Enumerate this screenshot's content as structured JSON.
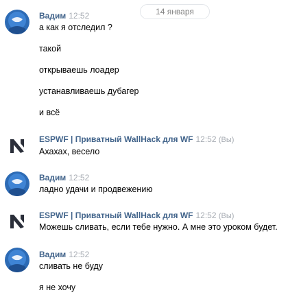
{
  "date_divider": "14 января",
  "colors": {
    "author": "#42648b",
    "time": "#a7acb3",
    "avatar_blue": "#2d6bb5",
    "text": "#000000"
  },
  "messages": [
    {
      "author": "Вадим",
      "time": "12:52",
      "avatar_icon": "blue-avatar-icon",
      "lines": [
        "а как я отследил ?",
        "такой",
        "открываешь лоадер",
        "устанавливаешь дубагер",
        "и всё"
      ]
    },
    {
      "author": "ESPWF | Приватный WallHack для WF",
      "time": "12:52",
      "you_label": "(Вы)",
      "avatar_icon": "espwf-logo-icon",
      "lines": [
        "Ахахах, весело"
      ]
    },
    {
      "author": "Вадим",
      "time": "12:52",
      "avatar_icon": "blue-avatar-icon",
      "lines": [
        "ладно удачи и продвежению"
      ]
    },
    {
      "author": "ESPWF | Приватный WallHack для WF",
      "time": "12:52",
      "you_label": "(Вы)",
      "avatar_icon": "espwf-logo-icon",
      "lines": [
        "Можешь сливать, если тебе нужно. А мне это уроком будет."
      ]
    },
    {
      "author": "Вадим",
      "time": "12:52",
      "avatar_icon": "blue-avatar-icon",
      "lines": [
        "сливать не буду",
        "я не хочу"
      ]
    }
  ]
}
